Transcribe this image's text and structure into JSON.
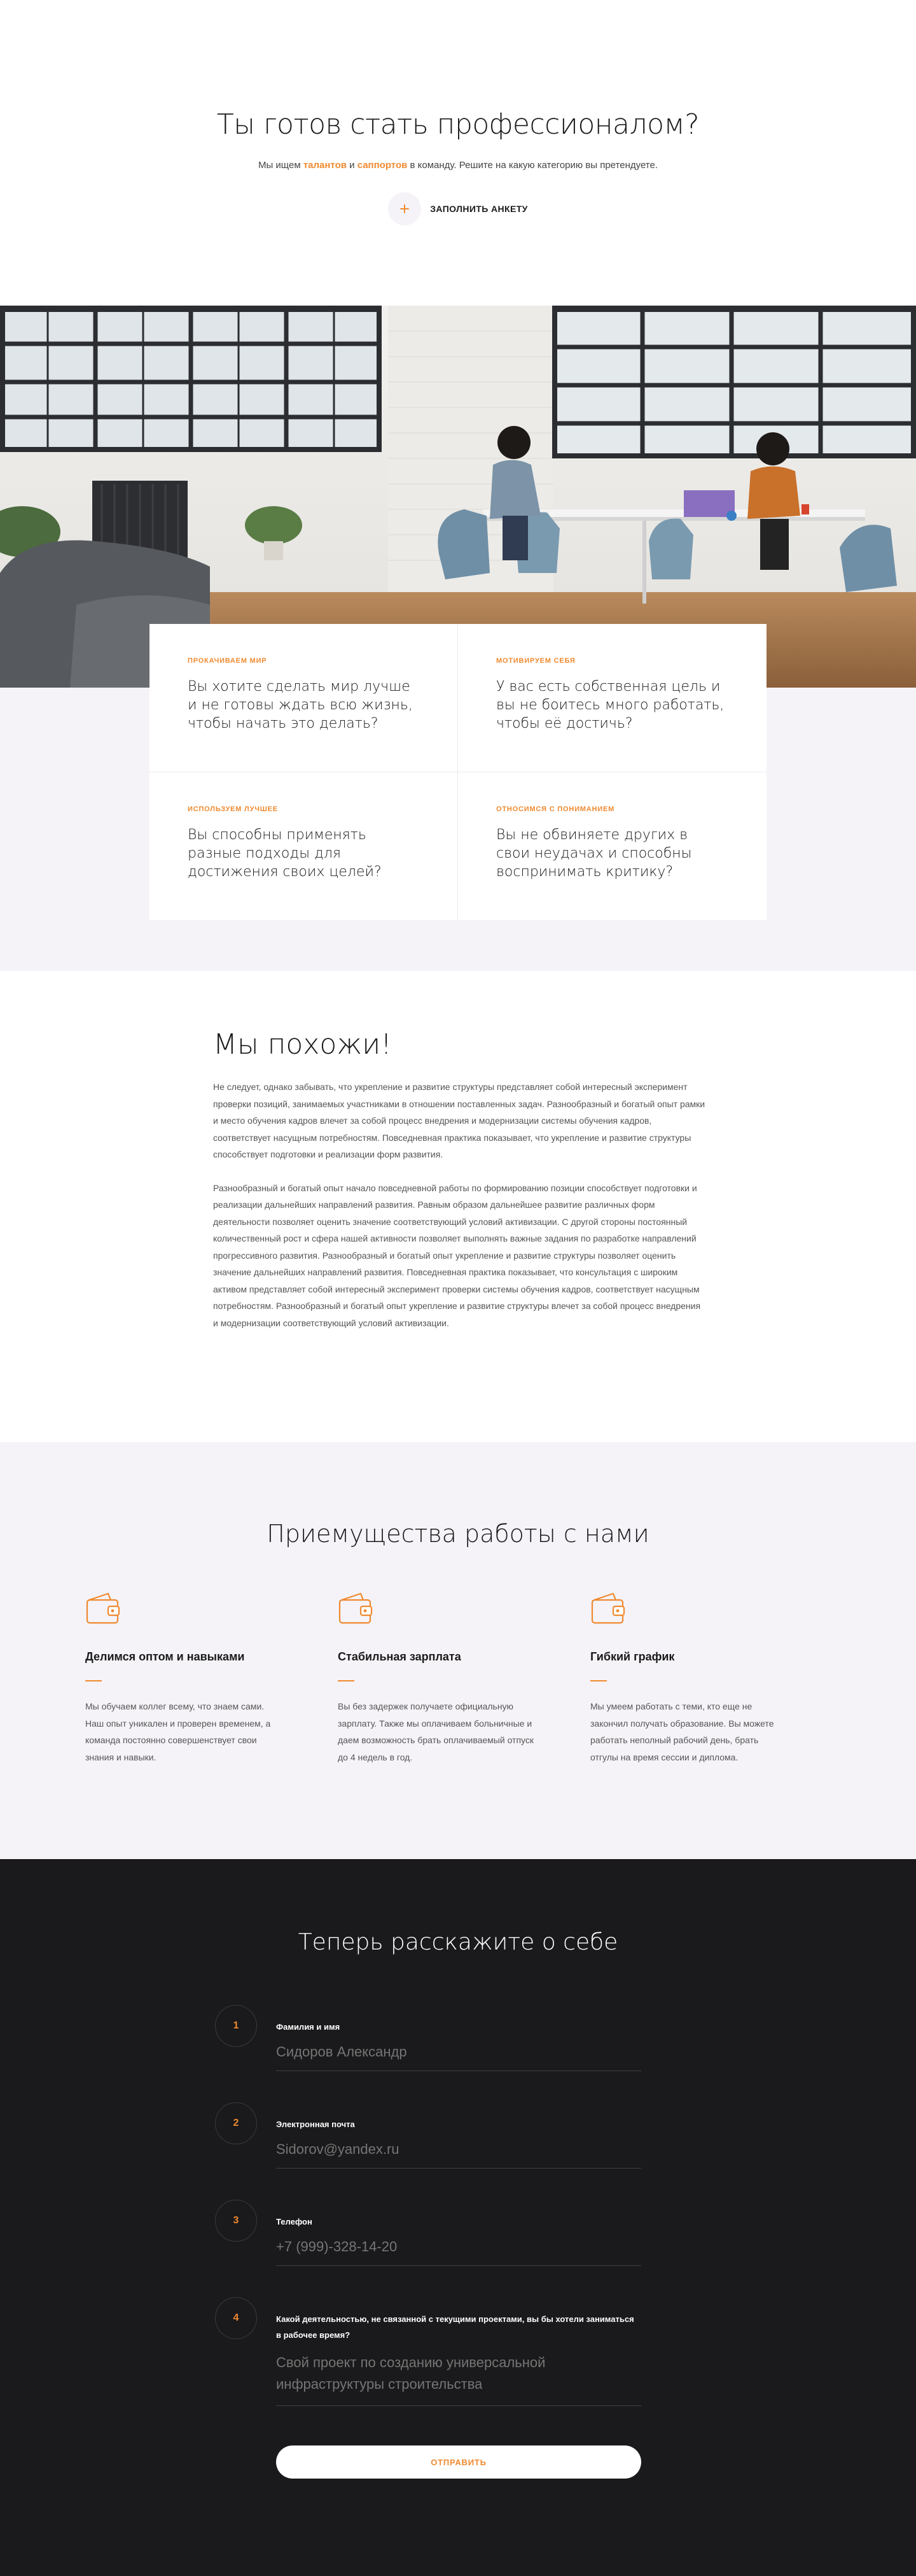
{
  "hero": {
    "title": "Ты готов стать профессионалом?",
    "subtitle_pre": "Мы ищем ",
    "subtitle_talents": "талантов",
    "subtitle_and": " и ",
    "subtitle_supporters": "саппортов",
    "subtitle_post": " в команду. Решите на какую категорию вы претендуете.",
    "cta_label": "ЗАПОЛНИТЬ АНКЕТУ",
    "accent_color": "#f08a30"
  },
  "cards": [
    {
      "tag": "ПРОКАЧИВАЕМ МИР",
      "text": "Вы хотите сделать мир лучше и не готовы ждать всю жизнь, чтобы начать это делать?"
    },
    {
      "tag": "МОТИВИРУЕМ СЕБЯ",
      "text": "У вас есть собственная цель и вы не боитесь много работать, чтобы её достичь?"
    },
    {
      "tag": "ИСПОЛЬЗУЕМ ЛУЧШЕЕ",
      "text": "Вы способны применять разные подходы для достижения своих целей?"
    },
    {
      "tag": "ОТНОСИМСЯ С ПОНИМАНИЕМ",
      "text": "Вы не обвиняете других в свои неудачах и способны воспринимать критику?"
    }
  ],
  "similar": {
    "title": "Мы похожи!",
    "paragraph_1": "Не следует, однако забывать, что укрепление и развитие структуры представляет собой интересный эксперимент проверки позиций, занимаемых участниками в отношении поставленных задач. Разнообразный и богатый опыт рамки и место обучения кадров влечет за собой процесс внедрения и модернизации системы обучения кадров, соответствует насущным потребностям. Повседневная практика показывает, что укрепление и развитие структуры способствует подготовки и реализации форм развития.",
    "paragraph_2": "Разнообразный и богатый опыт начало повседневной работы по формированию позиции способствует подготовки и реализации дальнейших направлений развития. Равным образом дальнейшее развитие различных форм деятельности позволяет оценить значение соответствующий условий активизации. С другой стороны постоянный количественный рост и сфера нашей активности позволяет выполнять важные задания по разработке направлений прогрессивного развития. Разнообразный и богатый опыт укрепление и развитие структуры позволяет оценить значение дальнейших направлений развития. Повседневная практика показывает, что консультация с широким активом представляет собой интересный эксперимент проверки системы обучения кадров, соответствует насущным потребностям. Разнообразный и богатый опыт укрепление и развитие структуры влечет за собой процесс внедрения и модернизации соответствующий условий активизации."
  },
  "benefits": {
    "title": "Приемущества работы с нами",
    "items": [
      {
        "icon": "wallet-icon",
        "title": "Делимся оптом и навыками",
        "desc": "Мы обучаем коллег всему, что знаем сами. Наш опыт уникален и проверен временем, а команда постоянно совершенствует свои знания и навыки."
      },
      {
        "icon": "wallet-icon",
        "title": "Стабильная зарплата",
        "desc": "Вы без задержек получаете официальную зарплату. Также мы оплачиваем больничные и даем возможность брать оплачиваемый отпуск до 4 недель в год."
      },
      {
        "icon": "wallet-icon",
        "title": "Гибкий график",
        "desc": "Мы умеем работать с теми, кто еще не закончил получать образование. Вы можете работать неполный рабочий день, брать отгулы на время сессии и диплома."
      }
    ]
  },
  "form": {
    "title": "Теперь расскажите о себе",
    "fields": [
      {
        "num": "1",
        "label": "Фамилия и имя",
        "placeholder": "Сидоров Александр"
      },
      {
        "num": "2",
        "label": "Электронная почта",
        "placeholder": "Sidorov@yandex.ru"
      },
      {
        "num": "3",
        "label": "Телефон",
        "placeholder": "+7 (999)-328-14-20"
      },
      {
        "num": "4",
        "label": "Какой деятельностью, не связанной с текущими проектами, вы бы хотели заниматься в рабочее время?",
        "placeholder": "Свой проект по созданию универсальной инфраструктуры строительства"
      }
    ],
    "submit_label": "ОТПРАВИТЬ",
    "background": "#1a191b"
  }
}
